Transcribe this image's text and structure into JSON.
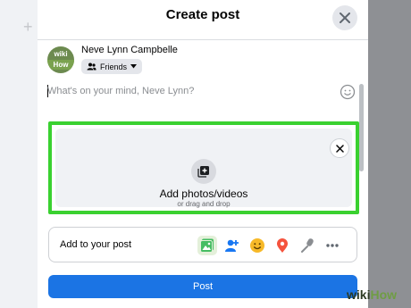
{
  "dialog": {
    "title": "Create post"
  },
  "user": {
    "name": "Neve Lynn Campbelle",
    "avatar_text_top": "wiki",
    "avatar_text_bottom": "How",
    "audience": "Friends",
    "audience_icon": "friends-icon"
  },
  "composer": {
    "placeholder": "What's on your mind, Neve Lynn?"
  },
  "media": {
    "title": "Add photos/videos",
    "subtitle": "or drag and drop",
    "highlight_color": "#3ad130"
  },
  "add_to_post": {
    "label": "Add to your post",
    "tools": [
      {
        "icon": "photo-video-icon",
        "color": "#45bd62"
      },
      {
        "icon": "tag-people-icon",
        "color": "#1877f2"
      },
      {
        "icon": "feeling-icon",
        "color": "#f7b928"
      },
      {
        "icon": "check-in-icon",
        "color": "#f5533d"
      },
      {
        "icon": "live-video-icon",
        "color": "#8a8d91"
      },
      {
        "icon": "more-icon",
        "color": "#606770"
      }
    ]
  },
  "post_button": {
    "label": "Post",
    "color": "#1b74e4"
  },
  "watermark": {
    "part1": "wiki",
    "part2": "How"
  }
}
